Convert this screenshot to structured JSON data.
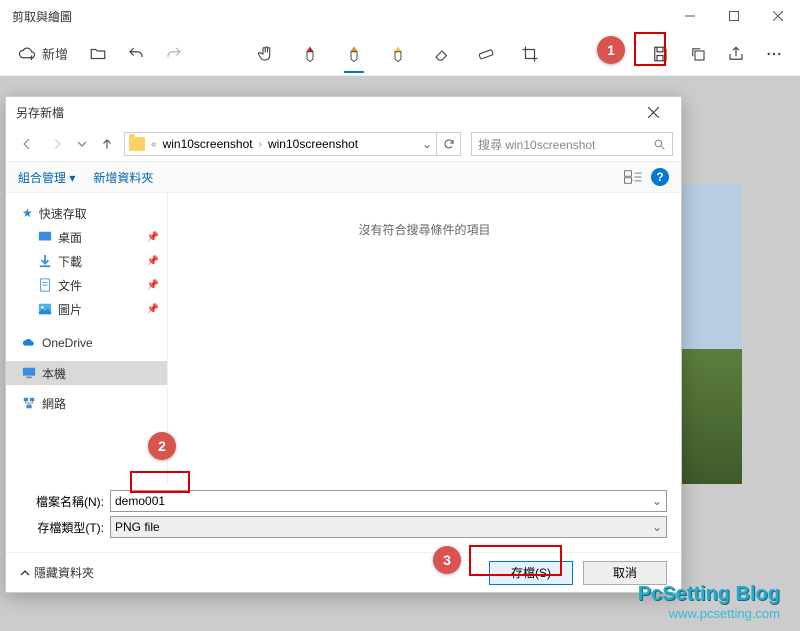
{
  "app": {
    "title": "剪取與繪圖",
    "new_label": "新增"
  },
  "dialog": {
    "title": "另存新檔",
    "path": {
      "sep": "«",
      "p1": "win10screenshot",
      "p2": "win10screenshot"
    },
    "search_placeholder": "搜尋 win10screenshot",
    "organize": "組合管理 ▾",
    "new_folder": "新增資料夾",
    "empty": "沒有符合搜尋條件的項目",
    "sidebar": {
      "quick": "快速存取",
      "desktop": "桌面",
      "downloads": "下載",
      "documents": "文件",
      "pictures": "圖片",
      "onedrive": "OneDrive",
      "thispc": "本機",
      "network": "網路"
    },
    "filename_label": "檔案名稱(N):",
    "filename_value": "demo001",
    "filetype_label": "存檔類型(T):",
    "filetype_value": "PNG file",
    "hide_folders": "隱藏資料夾",
    "save_btn": "存檔(S)",
    "cancel_btn": "取消"
  },
  "badges": {
    "b1": "1",
    "b2": "2",
    "b3": "3"
  },
  "watermark": {
    "l1": "PcSetting Blog",
    "l2": "www.pcsetting.com"
  }
}
